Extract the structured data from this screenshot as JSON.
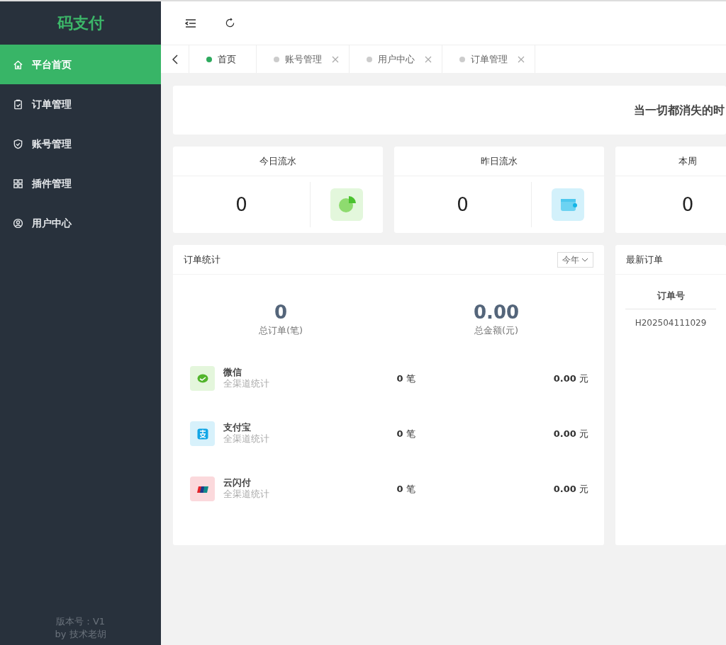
{
  "brand": "码支付",
  "sidebar": {
    "items": [
      {
        "label": "平台首页",
        "kind": "home",
        "selected": true
      },
      {
        "label": "订单管理",
        "kind": "clipboard",
        "selected": false
      },
      {
        "label": "账号管理",
        "kind": "shield",
        "selected": false
      },
      {
        "label": "插件管理",
        "kind": "grid",
        "selected": false
      },
      {
        "label": "用户中心",
        "kind": "user",
        "selected": false
      }
    ],
    "version": "版本号：V1",
    "author": "by 技术老胡"
  },
  "tabs": [
    {
      "label": "首页",
      "selected": true,
      "closable": false
    },
    {
      "label": "账号管理",
      "selected": false,
      "closable": true
    },
    {
      "label": "用户中心",
      "selected": false,
      "closable": true
    },
    {
      "label": "订单管理",
      "selected": false,
      "closable": true
    }
  ],
  "banner": {
    "text": "当一切都消失的时"
  },
  "stats": [
    {
      "title": "今日流水",
      "value": "0",
      "kind": "pie"
    },
    {
      "title": "昨日流水",
      "value": "0",
      "kind": "wallet"
    },
    {
      "title": "本周",
      "value": "0",
      "kind": "none"
    }
  ],
  "order_stats": {
    "title": "订单统计",
    "period": "今年",
    "totals": [
      {
        "value": "0",
        "label": "总订单(笔)"
      },
      {
        "value": "0.00",
        "label": "总金额(元)"
      }
    ],
    "channels": [
      {
        "name": "微信",
        "subtitle": "全渠道统计",
        "count": "**0** 笔",
        "amount": "**0.00** 元",
        "kind": "wechat"
      },
      {
        "name": "支付宝",
        "subtitle": "全渠道统计",
        "count": "**0** 笔",
        "amount": "**0.00** 元",
        "kind": "alipay"
      },
      {
        "name": "云闪付",
        "subtitle": "全渠道统计",
        "count": "**0** 笔",
        "amount": "**0.00** 元",
        "kind": "unionpay"
      }
    ]
  },
  "latest_orders": {
    "title": "最新订单",
    "columns": [
      "订单号"
    ],
    "rows": [
      [
        "H202504111029"
      ]
    ]
  }
}
